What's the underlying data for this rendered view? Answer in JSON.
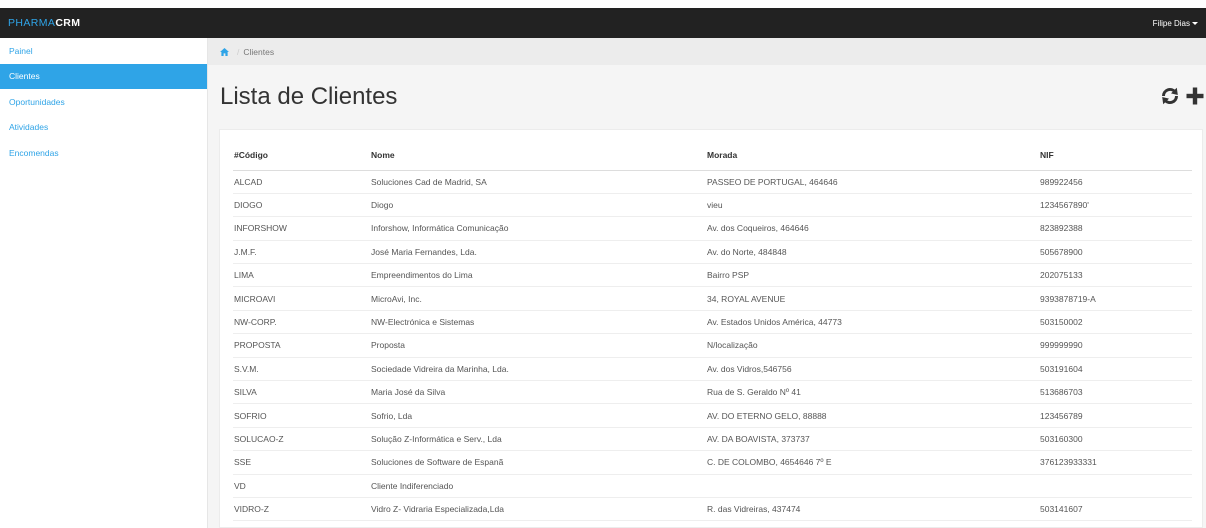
{
  "navbar": {
    "brand_part1": "PHARMA",
    "brand_part2": "CRM",
    "user_name": "Filipe Dias",
    "accent": "#2fa4e7",
    "background": "#222222"
  },
  "sidebar": {
    "items": [
      {
        "label": "Painel",
        "active": false
      },
      {
        "label": "Clientes",
        "active": true
      },
      {
        "label": "Oportunidades",
        "active": false
      },
      {
        "label": "Atividades",
        "active": false
      },
      {
        "label": "Encomendas",
        "active": false
      }
    ]
  },
  "breadcrumb": {
    "home_icon": "home-icon",
    "separator": "/",
    "current": "Clientes"
  },
  "page": {
    "title": "Lista de Clientes",
    "refresh_icon": "refresh-icon",
    "add_icon": "plus-icon"
  },
  "table": {
    "columns": [
      "#Código",
      "Nome",
      "Morada",
      "NIF"
    ],
    "rows": [
      [
        "ALCAD",
        "Soluciones Cad de Madrid, SA",
        "PASSEO DE PORTUGAL, 464646",
        "989922456"
      ],
      [
        "DIOGO",
        "Diogo",
        "vieu",
        "1234567890'"
      ],
      [
        "INFORSHOW",
        "Inforshow, Informática Comunicação",
        "Av. dos Coqueiros, 464646",
        "823892388"
      ],
      [
        "J.M.F.",
        "José Maria Fernandes, Lda.",
        "Av. do Norte, 484848",
        "505678900"
      ],
      [
        "LIMA",
        "Empreendimentos do Lima",
        "Bairro PSP",
        "202075133"
      ],
      [
        "MICROAVI",
        "MicroAvi, Inc.",
        "34, ROYAL AVENUE",
        "9393878719-A"
      ],
      [
        "NW-CORP.",
        "NW-Electrónica e Sistemas",
        "Av. Estados Unidos América, 44773",
        "503150002"
      ],
      [
        "PROPOSTA",
        "Proposta",
        "N/localização",
        "999999990"
      ],
      [
        "S.V.M.",
        "Sociedade Vidreira da Marinha, Lda.",
        "Av. dos Vidros,546756",
        "503191604"
      ],
      [
        "SILVA",
        "Maria José da Silva",
        "Rua de S. Geraldo Nº 41",
        "513686703"
      ],
      [
        "SOFRIO",
        "Sofrio, Lda",
        "AV. DO ETERNO GELO, 88888",
        "123456789"
      ],
      [
        "SOLUCAO-Z",
        "Solução Z-Informática e Serv., Lda",
        "AV. DA BOAVISTA, 373737",
        "503160300"
      ],
      [
        "SSE",
        "Soluciones de Software de Espanã",
        "C. DE COLOMBO, 4654646 7º E",
        "376123933331"
      ],
      [
        "VD",
        "Cliente Indiferenciado",
        "",
        ""
      ],
      [
        "VIDRO-Z",
        "Vidro Z- Vidraria Especializada,Lda",
        "R. das Vidreiras, 437474",
        "503141607"
      ]
    ]
  }
}
